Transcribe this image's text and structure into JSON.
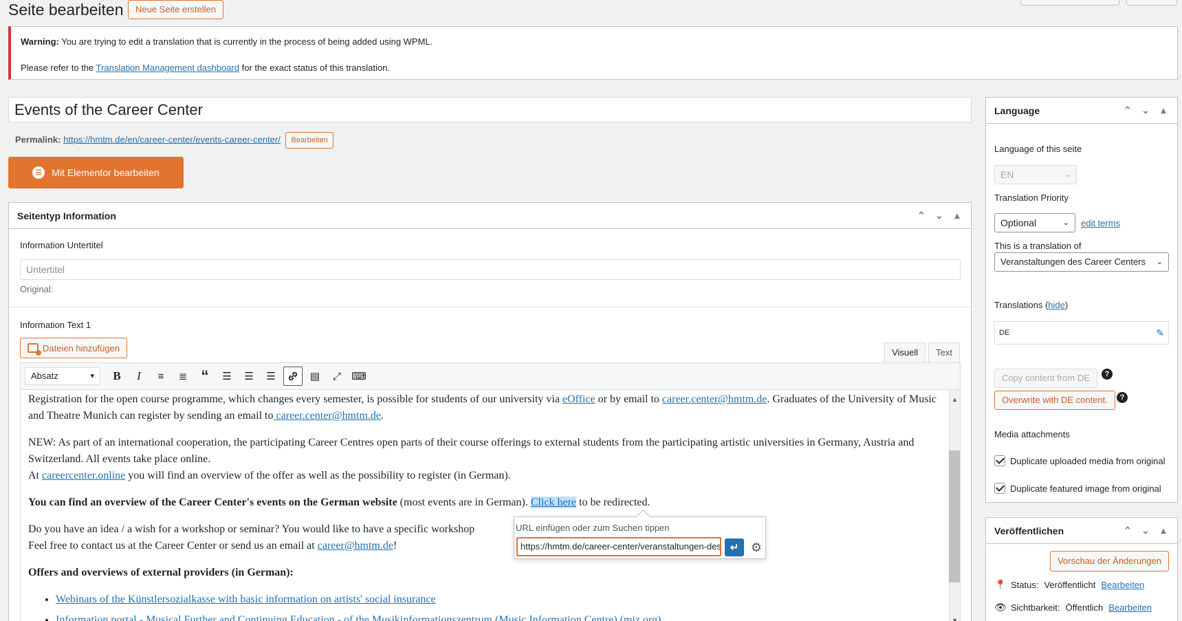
{
  "header": {
    "title": "Seite bearbeiten",
    "new_page_label": "Neue Seite erstellen"
  },
  "notice": {
    "warning_label": "Warning:",
    "warning_text": " You are trying to edit a translation that is currently in the process of being added using WPML.",
    "refer_pre": "Please refer to the ",
    "refer_link": "Translation Management dashboard",
    "refer_post": " for the exact status of this translation."
  },
  "post": {
    "title": "Events of the Career Center",
    "permalink_label": "Permalink:",
    "permalink_url": "https://hmtm.de/en/career-center/events-career-center/",
    "permalink_edit": "Bearbeiten",
    "elementor_label": "Mit Elementor bearbeiten"
  },
  "metabox": {
    "title": "Seitentyp Information",
    "subtitle_label": "Information Untertitel",
    "subtitle_placeholder": "Untertitel",
    "original_label": "Original:",
    "text_label": "Information Text 1",
    "add_files": "Dateien hinzufügen",
    "tab_visual": "Visuell",
    "tab_text": "Text",
    "format_value": "Absatz"
  },
  "content": {
    "p1_a": "Registration for the open course programme, which changes every semester, is possible for students of our university via ",
    "p1_link1": "eOffice",
    "p1_b": " or by email to ",
    "p1_link2": "career.center@hmtm.de",
    "p1_c": ". Graduates of the University of Music and Theatre Munich can register by sending an email to",
    "p1_link3": " career.center@hmtm.de",
    "p1_d": ".",
    "p2_a": "NEW: As part of an international cooperation, the participating Career Centres open parts of their course offerings to external students from the participating artistic universities in Germany, Austria and Switzerland. All events take place online.",
    "p2_b": "At ",
    "p2_link": "careercenter.online",
    "p2_c": " you will find an overview of the offer as well as the possibility to register (in German).",
    "p3_bold": "You can find an overview of the Career Center's events on the German website",
    "p3_a": " (most events are in German). ",
    "p3_link": "Click here",
    "p3_b": " to be redirected.",
    "p4_a": "Do you have an idea / a wish for a workshop or seminar? You would like to have a specific workshop",
    "p4_b": "Feel free to contact us at the Career Center or send us an email at ",
    "p4_link": "career@hmtm.de",
    "p4_c": "!",
    "p5_bold": "Offers and overviews of external providers (in German):",
    "list": [
      "Webinars of the Künstlersozialkasse with basic information on artists' social insurance",
      "Information portal - Musical Further and Continuing Education - of the Musikinformationszentrum (Music Information Centre) (miz.org)"
    ]
  },
  "link_popup": {
    "label": "URL einfügen oder zum Suchen tippen",
    "value": "https://hmtm.de/career-center/veranstaltungen-des-career-centers/"
  },
  "language_box": {
    "title": "Language",
    "lang_label": "Language of this seite",
    "lang_value": "EN",
    "priority_label": "Translation Priority",
    "priority_value": "Optional",
    "edit_terms": "edit terms",
    "translation_of_label": "This is a translation of",
    "translation_of_value": "Veranstaltungen des Career Centers",
    "translations_label": "Translations",
    "translations_hide": "hide",
    "translations_value": "DE",
    "copy_btn": "Copy content from DE",
    "overwrite_btn": "Overwrite with DE content.",
    "media_label": "Media attachments",
    "dup_media": "Duplicate uploaded media from original",
    "dup_featured": "Duplicate featured image from original"
  },
  "publish_box": {
    "title": "Veröffentlichen",
    "preview_btn": "Vorschau der Änderungen",
    "status_label": "Status:",
    "status_value": "Veröffentlicht",
    "status_edit": "Bearbeiten",
    "visibility_label": "Sichtbarkeit:",
    "visibility_value": "Öffentlich",
    "visibility_edit": "Bearbeiten"
  },
  "colors": {
    "accent_orange": "#e2742f",
    "link_blue": "#2271b1",
    "notice_red": "#d63638"
  }
}
